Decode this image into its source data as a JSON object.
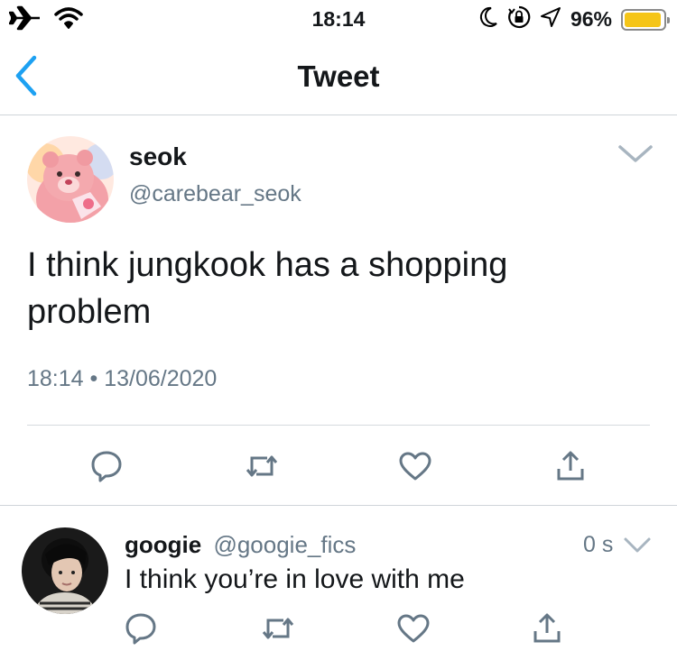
{
  "status_bar": {
    "time": "18:14",
    "battery_percent_label": "96%",
    "battery_level": 0.96,
    "battery_color": "#f5c518",
    "icons": [
      "airplane-icon",
      "wifi-icon",
      "moon-icon",
      "orientation-lock-icon",
      "location-arrow-icon",
      "battery-icon"
    ]
  },
  "nav": {
    "title": "Tweet",
    "back_icon": "chevron-left-icon"
  },
  "tweet": {
    "author_name": "seok",
    "author_handle": "@carebear_seok",
    "text": "I think jungkook has a shopping problem",
    "meta": "18:14 • 13/06/2020",
    "avatar": "pink care bear avatar",
    "actions": [
      "reply-icon",
      "retweet-icon",
      "like-icon",
      "share-icon"
    ]
  },
  "reply": {
    "author_name": "googie",
    "author_handle": "@googie_fics",
    "time": "0 s",
    "text": "I think you’re in love with me",
    "avatar": "person portrait avatar",
    "actions": [
      "reply-icon",
      "retweet-icon",
      "like-icon",
      "share-icon"
    ]
  },
  "colors": {
    "accent": "#1da1f2",
    "secondary_text": "#657786",
    "icon_gray": "#657786",
    "divider": "#cfd4d9"
  }
}
